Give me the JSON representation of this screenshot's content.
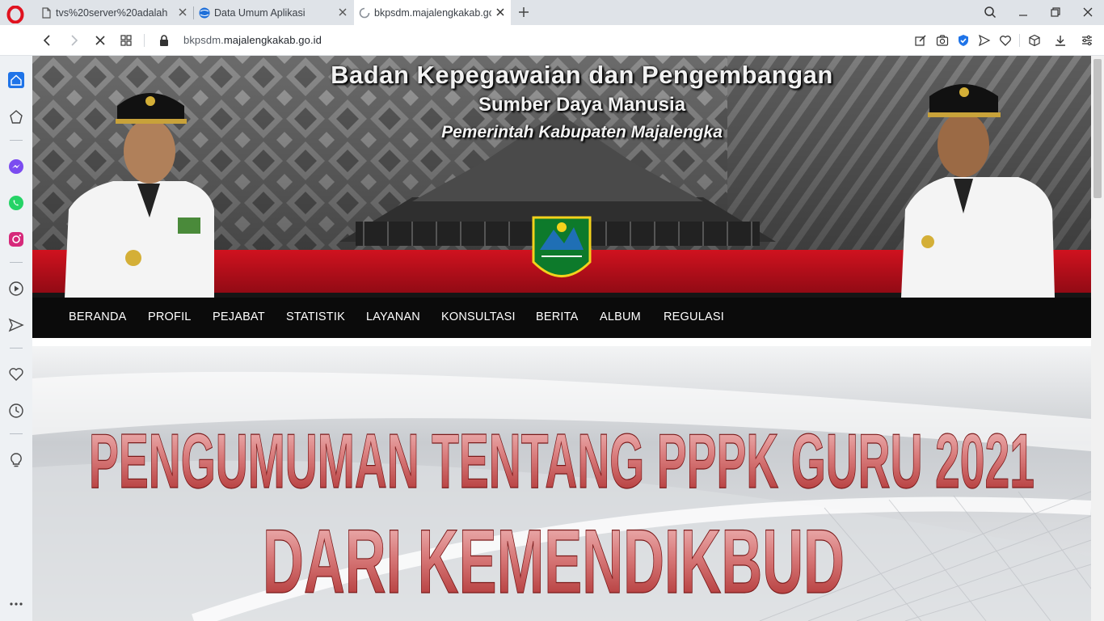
{
  "browser": {
    "tabs": [
      {
        "title": "tvs%20server%20adalah"
      },
      {
        "title": "Data Umum Aplikasi"
      },
      {
        "title": "bkpsdm.majalengkakab.go.id"
      }
    ],
    "url_prefix": "bkpsdm.",
    "url_domain": "majalengkakab.go.id"
  },
  "banner": {
    "line1": "Badan Kepegawaian dan Pengembangan",
    "line2": "Sumber Daya Manusia",
    "line3": "Pemerintah Kabupaten Majalengka"
  },
  "nav": {
    "items": [
      "BERANDA",
      "PROFIL",
      "PEJABAT",
      "STATISTIK",
      "LAYANAN",
      "KONSULTASI",
      "BERITA",
      "ALBUM",
      "REGULASI"
    ]
  },
  "hero": {
    "line1": "PENGUMUMAN TENTANG PPPK GURU 2021",
    "line2": "DARI KEMENDIKBUD"
  },
  "colors": {
    "accent_red": "#b3101b",
    "navbar": "#0b0b0b",
    "opera_red": "#e0121f",
    "vpn_blue": "#1f74e8"
  }
}
